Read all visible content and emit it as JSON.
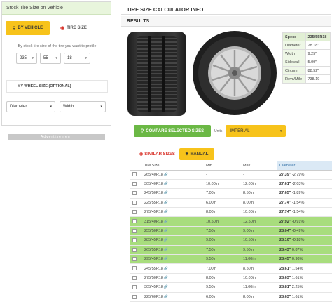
{
  "left": {
    "header": "Stock Tire Size on Vehicle",
    "tab_vehicle": "BY VEHICLE",
    "tab_size": "TIRE SIZE",
    "profile_text": "By stock tire size of the tire you want to profile",
    "width": "235",
    "aspect": "55",
    "rim": "18",
    "my_wheel": "+ MY WHEEL SIZE (OPTIONAL)",
    "dim1": "Diameter",
    "dim2": "Width",
    "advert": "Advertisement"
  },
  "right": {
    "title": "TIRE SIZE CALCULATOR INFO",
    "results": "RESULTS"
  },
  "specs": [
    {
      "k": "Specs",
      "v": "235/55R18"
    },
    {
      "k": "Diameter",
      "v": "28.18\""
    },
    {
      "k": "Width",
      "v": "9.25\""
    },
    {
      "k": "Sidewall",
      "v": "5.09\""
    },
    {
      "k": "Circum",
      "v": "88.52\""
    },
    {
      "k": "Revs/Mile",
      "v": "738.19"
    }
  ],
  "compare": {
    "button": "COMPARE SELECTED SIZES",
    "units_label": "Units",
    "units_value": "IMPERIAL"
  },
  "subtabs": {
    "similar": "SIMILAR SIZES",
    "manual": "MANUAL"
  },
  "table": {
    "headers": [
      "",
      "Tire Size",
      "Min",
      "Max",
      "Diameter"
    ],
    "rows": [
      {
        "size": "265/40R18",
        "min": "-",
        "max": "-",
        "dia": "27.39\"",
        "pct": "-2.79%",
        "hl": false
      },
      {
        "size": "305/40R18",
        "min": "10.00in",
        "max": "12.00in",
        "dia": "27.61\"",
        "pct": "-2.03%",
        "hl": false
      },
      {
        "size": "245/50R18",
        "min": "7.00in",
        "max": "8.50in",
        "dia": "27.65\"",
        "pct": "-1.89%",
        "hl": false
      },
      {
        "size": "225/55R18",
        "min": "6.00in",
        "max": "8.00in",
        "dia": "27.74\"",
        "pct": "-1.54%",
        "hl": false
      },
      {
        "size": "275/45R18",
        "min": "8.00in",
        "max": "10.00in",
        "dia": "27.74\"",
        "pct": "-1.54%",
        "hl": false
      },
      {
        "size": "315/40R18",
        "min": "10.50in",
        "max": "12.50in",
        "dia": "27.92\"",
        "pct": "-0.91%",
        "hl": true
      },
      {
        "size": "255/50R18",
        "min": "7.50in",
        "max": "9.00in",
        "dia": "28.04\"",
        "pct": "-0.49%",
        "hl": true
      },
      {
        "size": "285/45R18",
        "min": "9.00in",
        "max": "10.50in",
        "dia": "28.10\"",
        "pct": "-0.28%",
        "hl": true
      },
      {
        "size": "265/55R18",
        "min": "7.50in",
        "max": "9.50in",
        "dia": "28.43\"",
        "pct": "0.87%",
        "hl": true
      },
      {
        "size": "295/45R18",
        "min": "9.50in",
        "max": "11.00in",
        "dia": "28.45\"",
        "pct": "0.98%",
        "hl": true
      },
      {
        "size": "245/55R18",
        "min": "7.00in",
        "max": "8.50in",
        "dia": "28.61\"",
        "pct": "1.54%",
        "hl": false
      },
      {
        "size": "275/50R18",
        "min": "8.00in",
        "max": "10.00in",
        "dia": "28.63\"",
        "pct": "1.61%",
        "hl": false
      },
      {
        "size": "305/45R18",
        "min": "9.50in",
        "max": "11.00in",
        "dia": "28.81\"",
        "pct": "2.25%",
        "hl": false
      },
      {
        "size": "225/60R18",
        "min": "6.00in",
        "max": "8.00in",
        "dia": "28.63\"",
        "pct": "1.61%",
        "hl": false
      }
    ]
  }
}
